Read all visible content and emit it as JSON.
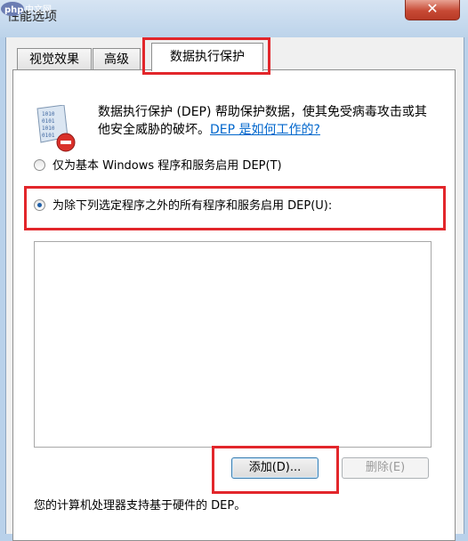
{
  "window": {
    "title": "性能选项",
    "close_glyph": "✕"
  },
  "watermark": {
    "text": "php 中文网"
  },
  "tabs": [
    {
      "label": "视觉效果"
    },
    {
      "label": "高级"
    },
    {
      "label": "数据执行保护"
    }
  ],
  "dep": {
    "description": "数据执行保护 (DEP) 帮助保护数据，使其免受病毒攻击或其他安全威胁的破坏。",
    "link": "DEP 是如何工作的?",
    "icon": "dep-shield-icon"
  },
  "options": {
    "essential_only": "仅为基本 Windows 程序和服务启用 DEP(T)",
    "all_except": "为除下列选定程序之外的所有程序和服务启用 DEP(U):",
    "selected": "all_except"
  },
  "buttons": {
    "add": "添加(D)...",
    "remove": "删除(E)"
  },
  "footer": {
    "hardware_support": "您的计算机处理器支持基于硬件的 DEP。"
  },
  "colors": {
    "highlight_red": "#e2262b",
    "link_blue": "#0066cc"
  }
}
